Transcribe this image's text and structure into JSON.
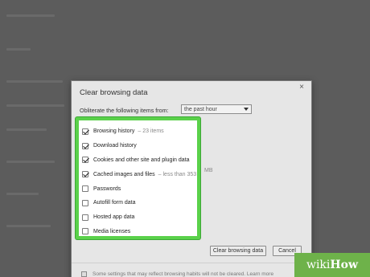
{
  "dialog": {
    "title": "Clear browsing data",
    "close_icon": "×",
    "obliterate_label": "Obliterate the following items from:",
    "time_range": "the past hour",
    "items": [
      {
        "label": "Browsing history",
        "note": "– 23 items",
        "checked": true
      },
      {
        "label": "Download history",
        "note": "",
        "checked": true
      },
      {
        "label": "Cookies and other site and plugin data",
        "note": "",
        "checked": true
      },
      {
        "label": "Cached images and files",
        "note": "– less than 353",
        "checked": true
      },
      {
        "label": "Passwords",
        "note": "",
        "checked": false
      },
      {
        "label": "Autofill form data",
        "note": "",
        "checked": false
      },
      {
        "label": "Hosted app data",
        "note": "",
        "checked": false
      },
      {
        "label": "Media licenses",
        "note": "",
        "checked": false
      }
    ],
    "overflow_note": "MB",
    "clear_button": "Clear browsing data",
    "cancel_button": "Cancel",
    "footer_text": "Some settings that may reflect browsing habits will not be cleared. Learn more"
  },
  "watermark": {
    "part1": "wiki",
    "part2": "How",
    "color": "#6eb24a"
  },
  "colors": {
    "highlight": "#5ad14a",
    "overlay": "#5c5c5c"
  }
}
